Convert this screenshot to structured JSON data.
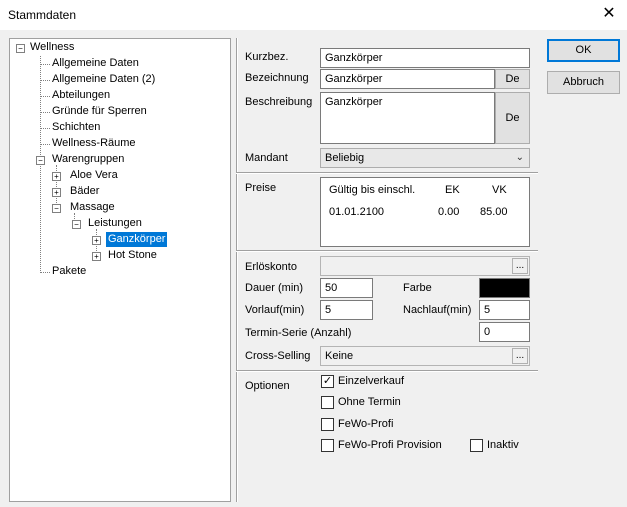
{
  "window": {
    "title": "Stammdaten",
    "close_glyph": "✕"
  },
  "tree": {
    "root": "Wellness",
    "items": [
      "Allgemeine Daten",
      "Allgemeine Daten (2)",
      "Abteilungen",
      "Gründe für Sperren",
      "Schichten",
      "Wellness-Räume",
      "Warengruppen",
      "Aloe Vera",
      "Bäder",
      "Massage",
      "Leistungen",
      "Ganzkörper",
      "Hot Stone",
      "Pakete"
    ]
  },
  "form": {
    "kurzbez": {
      "label": "Kurzbez.",
      "value": "Ganzkörper"
    },
    "bezeichnung": {
      "label": "Bezeichnung",
      "value": "Ganzkörper",
      "btn": "De"
    },
    "beschreibung": {
      "label": "Beschreibung",
      "value": "Ganzkörper",
      "btn": "De"
    },
    "mandant": {
      "label": "Mandant",
      "value": "Beliebig"
    },
    "preise": {
      "label": "Preise",
      "columns": [
        "Gültig bis einschl.",
        "EK",
        "VK"
      ],
      "rows": [
        [
          "01.01.2100",
          "0.00",
          "85.00"
        ]
      ]
    },
    "erloeskonto": {
      "label": "Erlöskonto",
      "value": "",
      "btn": "..."
    },
    "dauer": {
      "label": "Dauer (min)",
      "value": "50"
    },
    "farbe": {
      "label": "Farbe",
      "color": "#000000"
    },
    "vorlauf": {
      "label": "Vorlauf(min)",
      "value": "5"
    },
    "nachlauf": {
      "label": "Nachlauf(min)",
      "value": "5"
    },
    "terminserie": {
      "label": "Termin-Serie (Anzahl)",
      "value": "0"
    },
    "crossselling": {
      "label": "Cross-Selling",
      "value": "Keine",
      "btn": "..."
    },
    "optionen": {
      "label": "Optionen",
      "einzelverkauf": {
        "label": "Einzelverkauf",
        "checked": true
      },
      "ohne_termin": {
        "label": "Ohne Termin",
        "checked": false
      },
      "fewo_profi": {
        "label": "FeWo-Profi",
        "checked": false
      },
      "fewo_profi_provision": {
        "label": "FeWo-Profi Provision",
        "checked": false
      },
      "inaktiv": {
        "label": "Inaktiv",
        "checked": false
      }
    }
  },
  "buttons": {
    "ok": "OK",
    "abbruch": "Abbruch"
  },
  "glyphs": {
    "check": "✓",
    "chevron": "⌄",
    "plus": "+",
    "minus": "−"
  }
}
